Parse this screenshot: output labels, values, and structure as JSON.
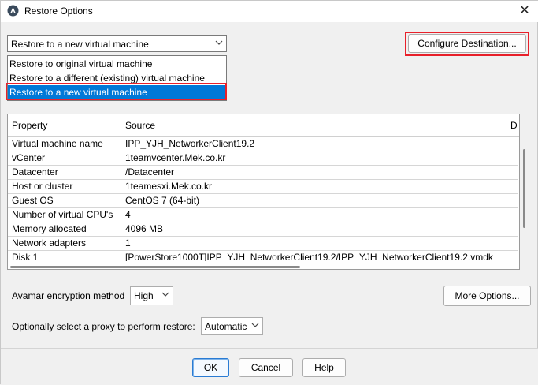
{
  "window": {
    "title": "Restore Options",
    "close_glyph": "✕"
  },
  "restore_target": {
    "selected": "Restore to a new virtual machine",
    "options": [
      "Restore to original virtual machine",
      "Restore to a different (existing) virtual machine",
      "Restore to a new virtual machine"
    ],
    "dropdown_open": true,
    "highlighted_index": 2
  },
  "configure_destination_label": "Configure Destination...",
  "properties_table": {
    "headers": [
      "Property",
      "Source",
      "D"
    ],
    "rows": [
      [
        "Virtual machine name",
        "IPP_YJH_NetworkerClient19.2"
      ],
      [
        "vCenter",
        "1teamvcenter.Mek.co.kr"
      ],
      [
        "Datacenter",
        "/Datacenter"
      ],
      [
        "Host or cluster",
        "1teamesxi.Mek.co.kr"
      ],
      [
        "Guest OS",
        "CentOS 7 (64-bit)"
      ],
      [
        "Number of virtual CPU's",
        "4"
      ],
      [
        "Memory allocated",
        "4096 MB"
      ],
      [
        "Network adapters",
        "1"
      ],
      [
        "Disk  1",
        "[PowerStore1000T]IPP_YJH_NetworkerClient19.2/IPP_YJH_NetworkerClient19.2.vmdk"
      ]
    ]
  },
  "encryption": {
    "label": "Avamar encryption method",
    "value": "High"
  },
  "more_options_label": "More Options...",
  "proxy": {
    "label": "Optionally select a proxy to perform restore:",
    "value": "Automatic"
  },
  "buttons": {
    "ok": "OK",
    "cancel": "Cancel",
    "help": "Help"
  },
  "icons": {
    "app": "avamar-logo-icon",
    "dropdown": "chevron-down-icon",
    "close": "close-icon"
  }
}
